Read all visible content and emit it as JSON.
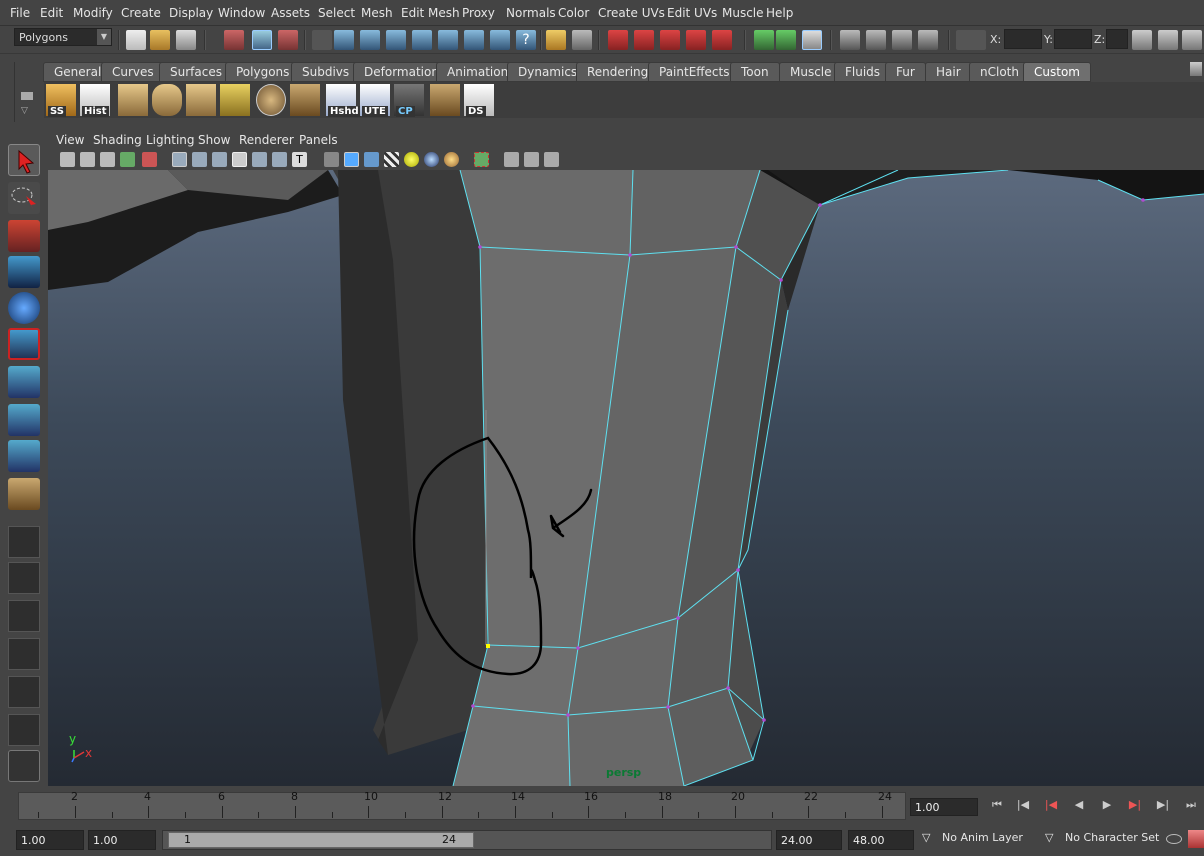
{
  "menubar": {
    "items": [
      "File",
      "Edit",
      "Modify",
      "Create",
      "Display",
      "Window",
      "Assets",
      "Select",
      "Mesh",
      "Edit Mesh",
      "Proxy",
      "Normals",
      "Color",
      "Create UVs",
      "Edit UVs",
      "Muscle",
      "Help"
    ]
  },
  "statusline": {
    "mode_menu": "Polygons",
    "coord_x_label": "X:",
    "coord_y_label": "Y:",
    "coord_z_label": "Z:"
  },
  "shelf": {
    "tabs": [
      "General",
      "Curves",
      "Surfaces",
      "Polygons",
      "Subdivs",
      "Deformation",
      "Animation",
      "Dynamics",
      "Rendering",
      "PaintEffects",
      "Toon",
      "Muscle",
      "Fluids",
      "Fur",
      "Hair",
      "nCloth",
      "Custom"
    ],
    "active_tab": "Custom",
    "buttons": [
      {
        "label": "SS",
        "icon": "folder-icon"
      },
      {
        "label": "Hist",
        "icon": "history-icon"
      },
      {
        "label": "",
        "icon": "cube-icon"
      },
      {
        "label": "",
        "icon": "cylinder-icon"
      },
      {
        "label": "",
        "icon": "plane-icon"
      },
      {
        "label": "",
        "icon": "uv-layout-icon"
      },
      {
        "label": "",
        "icon": "sphere-texture-icon"
      },
      {
        "label": "",
        "icon": "extract-icon"
      },
      {
        "label": "Hshd",
        "icon": "hide-shading-icon"
      },
      {
        "label": "UTE",
        "icon": "uv-editor-icon"
      },
      {
        "label": "CP",
        "icon": "center-pivot-icon"
      },
      {
        "label": "",
        "icon": "split-tool-icon"
      },
      {
        "label": "DS",
        "icon": "delete-shelf-icon"
      }
    ]
  },
  "panel_menu": {
    "items": [
      "View",
      "Shading",
      "Lighting",
      "Show",
      "Renderer",
      "Panels"
    ]
  },
  "viewport": {
    "camera": "persp",
    "axis_y": "y",
    "axis_x": "x"
  },
  "timeslider": {
    "ticks": [
      "2",
      "4",
      "6",
      "8",
      "10",
      "12",
      "14",
      "16",
      "18",
      "20",
      "22",
      "24"
    ],
    "current_frame": "1.00"
  },
  "range": {
    "anim_start": "1.00",
    "playback_start": "1.00",
    "range_start_label": "1",
    "range_end_label": "24",
    "playback_end": "24.00",
    "anim_end": "48.00",
    "anim_layer": "No Anim Layer",
    "character_set": "No Character Set"
  },
  "colors": {
    "wireframe_highlight": "#5ee0f0",
    "vertex_selected": "#ffff00",
    "annotation_stroke": "#000000"
  }
}
